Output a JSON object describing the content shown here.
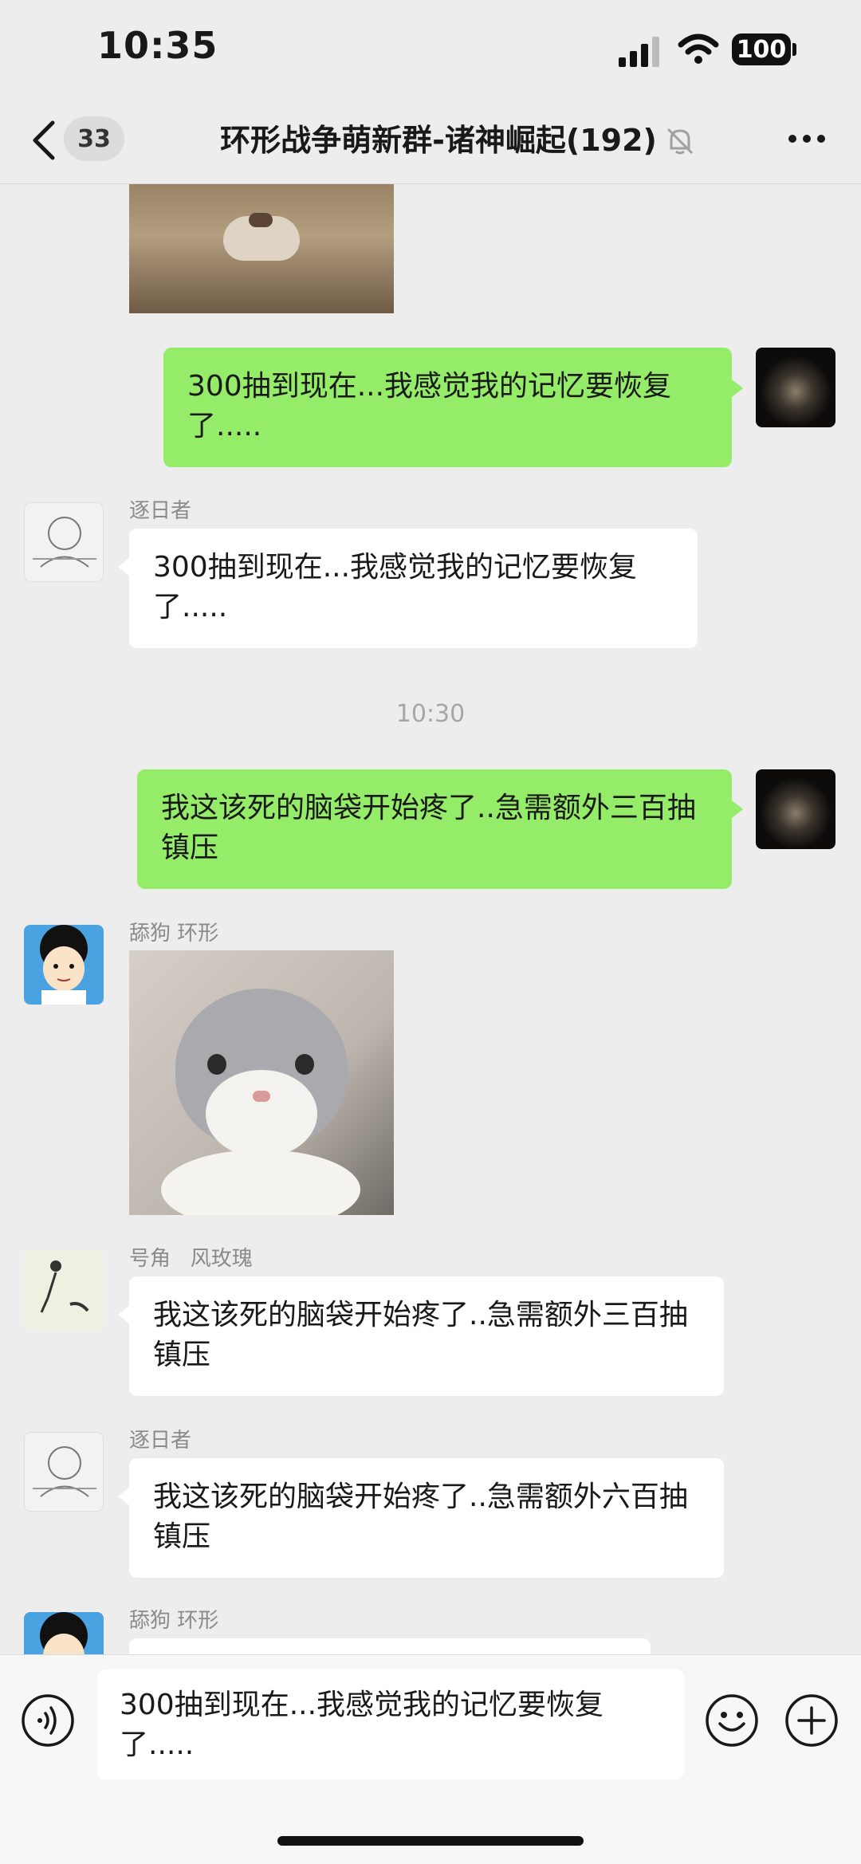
{
  "status_bar": {
    "time": "10:35",
    "battery": "100"
  },
  "header": {
    "unread_count": "33",
    "title": "环形战争萌新群-诸神崛起(192)"
  },
  "messages": [
    {
      "type": "image",
      "from": "other",
      "description": "cat photo (cropped)"
    },
    {
      "type": "text",
      "from": "me",
      "text": "300抽到现在...我感觉我的记忆要恢复了....."
    },
    {
      "type": "text",
      "from": "other",
      "sender": "逐日者",
      "text": "300抽到现在...我感觉我的记忆要恢复了....."
    },
    {
      "type": "timestamp",
      "text": "10:30"
    },
    {
      "type": "text",
      "from": "me",
      "text": "我这该死的脑袋开始疼了..急需额外三百抽镇压"
    },
    {
      "type": "image",
      "from": "other",
      "sender": "舔狗 环形",
      "description": "grey and white cat"
    },
    {
      "type": "text",
      "from": "other",
      "sender": "号角   风玫瑰",
      "text": "我这该死的脑袋开始疼了..急需额外三百抽镇压"
    },
    {
      "type": "text",
      "from": "other",
      "sender": "逐日者",
      "text": "我这该死的脑袋开始疼了..急需额外六百抽镇压"
    },
    {
      "type": "text",
      "from": "other",
      "sender": "舔狗 环形",
      "text": ""
    }
  ],
  "input": {
    "value": "300抽到现在...我感觉我的记忆要恢复了....."
  },
  "colors": {
    "my_bubble": "#95ec69",
    "other_bubble": "#ffffff",
    "background": "#ededed"
  },
  "icons": [
    "signal-icon",
    "wifi-icon",
    "back-chevron-icon",
    "mute-bell-icon",
    "more-icon",
    "voice-icon",
    "emoji-icon",
    "plus-icon"
  ]
}
